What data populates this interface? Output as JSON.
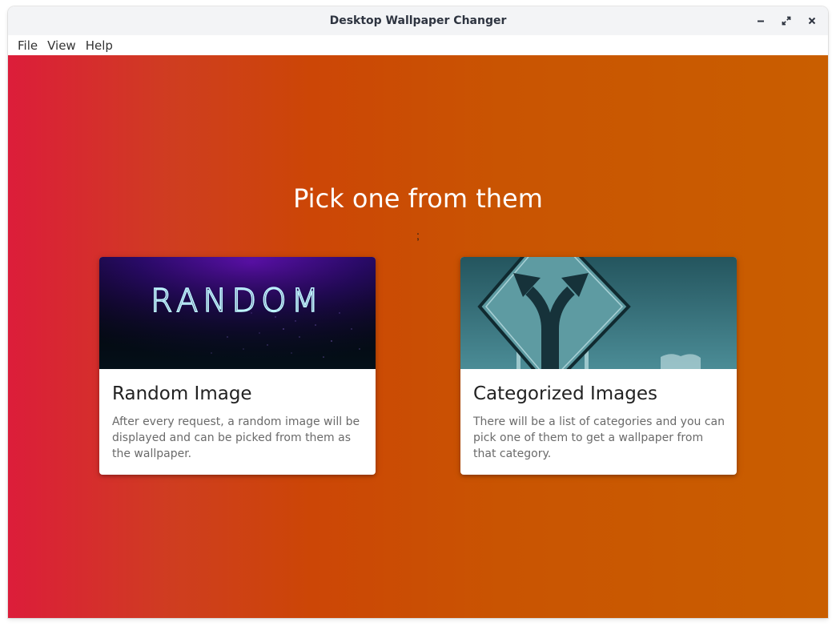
{
  "window": {
    "title": "Desktop Wallpaper Changer",
    "controls": [
      "minimize-icon",
      "maximize-icon",
      "close-icon"
    ]
  },
  "menu": {
    "items": [
      {
        "label": "File"
      },
      {
        "label": "View"
      },
      {
        "label": "Help"
      }
    ]
  },
  "main": {
    "heading": "Pick one from them",
    "separator": ";",
    "cards": [
      {
        "title": "Random Image",
        "description": "After every request, a random image will be displayed and can be picked from them as the wallpaper.",
        "image_text": "RANDOM",
        "image_icon": "random-neon-image"
      },
      {
        "title": "Categorized Images",
        "description": "There will be a list of categories and you can pick one of them to get a wallpaper from that category.",
        "image_icon": "fork-road-sign-image"
      }
    ]
  },
  "colors": {
    "gradient_start": "#dc1d3a",
    "gradient_mid": "#cc4606",
    "gradient_end": "#c95e00",
    "card_background": "#ffffff",
    "title_text": "#2e3440"
  }
}
